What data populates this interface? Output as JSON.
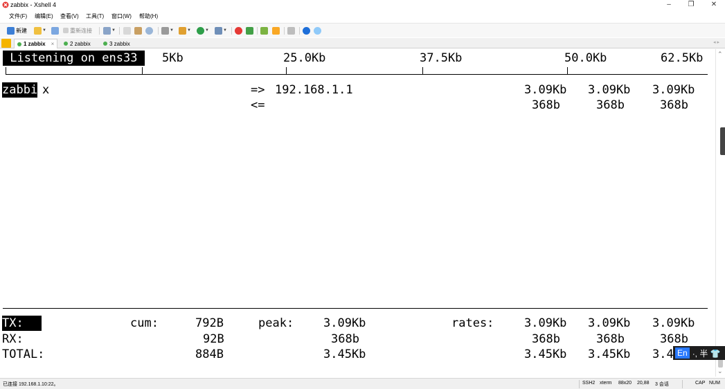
{
  "window": {
    "title": "zabbix - Xshell 4",
    "icons": {
      "app": "xshell-app-icon",
      "minimize": "minimize-icon",
      "maximize": "maximize-icon",
      "close": "close-icon"
    },
    "buttons": {
      "minimize": "–",
      "maximize": "❐",
      "close": "✕"
    }
  },
  "menu": [
    "文件(F)",
    "编辑(E)",
    "查看(V)",
    "工具(T)",
    "窗口(W)",
    "帮助(H)"
  ],
  "toolbar": {
    "new_label": "新建",
    "reconnect_label": "重新连接"
  },
  "tabs": [
    {
      "label": "1 zabbix",
      "close": "×"
    },
    {
      "label": "2 zabbix"
    },
    {
      "label": "3 zabbix"
    }
  ],
  "terminal": {
    "header_label": " Listening on ens33 ",
    "scale_labels": [
      "5Kb",
      "25.0Kb",
      "37.5Kb",
      "50.0Kb",
      "62.5Kb"
    ],
    "host_highlight": "zabbi",
    "host_rest": "x",
    "rows": [
      {
        "direction": "=>",
        "peer": "192.168.1.1",
        "rate_2s": "3.09Kb",
        "rate_10s": "3.09Kb",
        "rate_40s": "3.09Kb"
      },
      {
        "direction": "<=",
        "peer": "",
        "rate_2s": "368b",
        "rate_10s": "368b",
        "rate_40s": "368b"
      }
    ],
    "footer": {
      "cum_label": "cum:",
      "peak_label": "peak:",
      "rates_label": "rates:",
      "tx": {
        "label": "TX:",
        "cum": "792B",
        "peak": "3.09Kb",
        "r1": "3.09Kb",
        "r2": "3.09Kb",
        "r3": "3.09Kb"
      },
      "rx": {
        "label": "RX:",
        "cum": "92B",
        "peak": "368b",
        "r1": "368b",
        "r2": "368b",
        "r3": "368b"
      },
      "total": {
        "label": "TOTAL:",
        "cum": "884B",
        "peak": "3.45Kb",
        "r1": "3.45Kb",
        "r2": "3.45Kb",
        "r3_visible": "3.4"
      }
    }
  },
  "ime": {
    "mode": "En",
    "rest": "·, 半 👕"
  },
  "statusbar": {
    "connection": "已连接 192.168.1.10:22。",
    "protocol": "SSH2",
    "term": "xterm",
    "size": "88x20",
    "cursor": "20,88",
    "sessions": "3 会话",
    "cap": "CAP",
    "num": "NUM"
  },
  "colors": {
    "terminal_bg": "#ffffff",
    "terminal_fg": "#000000",
    "ime_accent": "#2979ff",
    "tab_pin": "#f5b400"
  }
}
